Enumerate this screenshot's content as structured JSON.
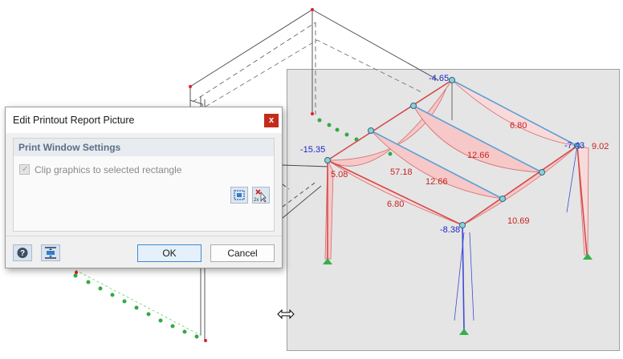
{
  "dialog": {
    "title": "Edit Printout Report Picture",
    "close_label": "x",
    "group_title": "Print Window Settings",
    "checkbox_label": "Clip graphics to selected rectangle",
    "checkbox_checked": true,
    "checkbox_enabled": false,
    "ok_label": "OK",
    "cancel_label": "Cancel",
    "icons": [
      "select-window-icon",
      "clear-window-icon",
      "help-icon",
      "fit-window-icon"
    ]
  },
  "model_labels": {
    "values": [
      "-4.65",
      "-15.35",
      "5.08",
      "57.18",
      "6.80",
      "12.66",
      "12.66",
      "6.80",
      "-7.43",
      "9.02",
      "-8.38",
      "10.69"
    ],
    "negative_color": "#1b27c9",
    "positive_color": "#cc1f1f"
  },
  "colors": {
    "selection_rect": "#e5e5e5",
    "diagram_fill": "#f6c8c8",
    "member_blue": "#5aa0d6",
    "support_green": "#2fa843"
  }
}
